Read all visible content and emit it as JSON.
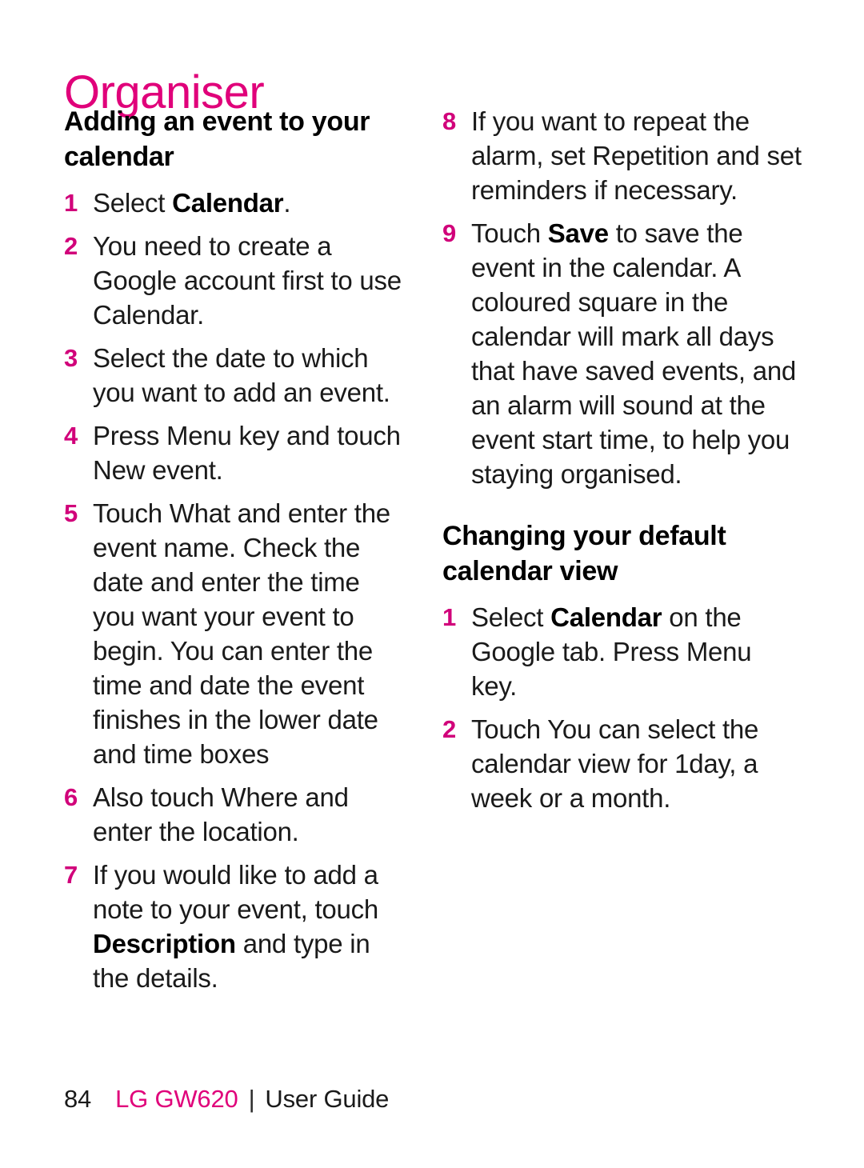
{
  "chapter": {
    "title": "Organiser",
    "accent_color": "#e0007a"
  },
  "colors": {
    "accent": "#e0007a",
    "step_number": "#d1007a",
    "body_text": "#1a1a1a"
  },
  "left_column": {
    "heading": "Adding an event to your calendar",
    "steps": [
      {
        "num": "1",
        "pre": "Select ",
        "bold": "Calendar",
        "post": "."
      },
      {
        "num": "2",
        "pre": "You need to create a Google account first to use Calendar.",
        "bold": "",
        "post": ""
      },
      {
        "num": "3",
        "pre": "Select the date to which you want to add an event.",
        "bold": "",
        "post": ""
      },
      {
        "num": "4",
        "pre": "Press Menu key and touch New event.",
        "bold": "",
        "post": ""
      },
      {
        "num": "5",
        "pre": "Touch What and enter the event name. Check the date and enter the time you want your event to begin. You can enter the time and date the event finishes in the lower date and time boxes",
        "bold": "",
        "post": ""
      },
      {
        "num": "6",
        "pre": "Also touch Where and enter the location.",
        "bold": "",
        "post": ""
      },
      {
        "num": "7",
        "pre": "If you would like to add a note to your event, touch ",
        "bold": "Description",
        "post": " and type in the details."
      }
    ]
  },
  "right_column": {
    "steps_continued": [
      {
        "num": "8",
        "pre": "If you want to repeat the alarm, set Repetition and set reminders if necessary.",
        "bold": "",
        "post": ""
      },
      {
        "num": "9",
        "pre": "Touch ",
        "bold": "Save",
        "post": " to save the event in the calendar. A coloured square in the calendar will mark all days that have saved events, and an alarm will sound at the event start time, to help you staying organised."
      }
    ],
    "heading": "Changing your default calendar view",
    "steps": [
      {
        "num": "1",
        "pre": "Select ",
        "bold": "Calendar",
        "post": " on the Google tab. Press Menu key."
      },
      {
        "num": "2",
        "pre": "Touch You can select the calendar view for 1day, a week or a month.",
        "bold": "",
        "post": ""
      }
    ]
  },
  "footer": {
    "page_number": "84",
    "model": "LG GW620",
    "separator": "|",
    "guide_label": "User Guide"
  }
}
